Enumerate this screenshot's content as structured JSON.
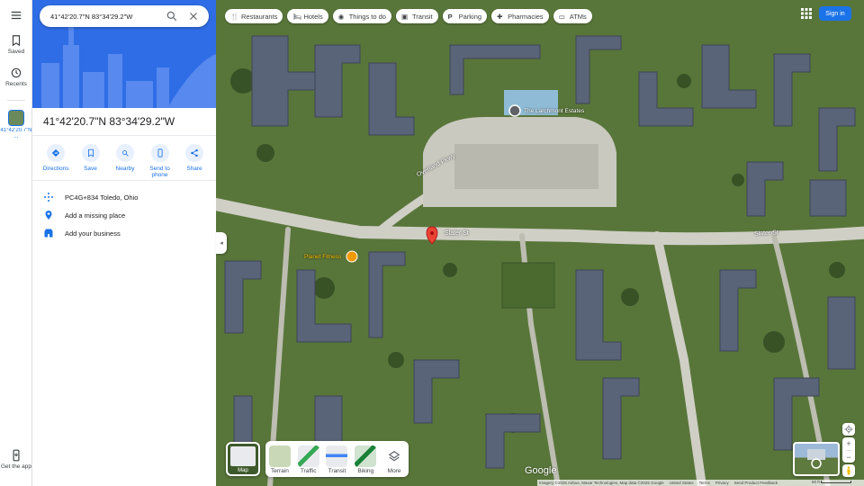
{
  "search": {
    "value": "41°42'20.7\"N 83°34'29.2\"W"
  },
  "rail": {
    "menu": "menu-icon",
    "saved": "Saved",
    "recents": "Recents",
    "recent_place": "41°42'20.7\"N ...",
    "get_app": "Get the app"
  },
  "place": {
    "title": "41°42'20.7\"N 83°34'29.2\"W",
    "actions": [
      {
        "label": "Directions",
        "icon": "directions-icon"
      },
      {
        "label": "Save",
        "icon": "bookmark-icon"
      },
      {
        "label": "Nearby",
        "icon": "nearby-icon"
      },
      {
        "label": "Send to phone",
        "icon": "phone-icon"
      },
      {
        "label": "Share",
        "icon": "share-icon"
      }
    ],
    "rows": [
      {
        "text": "PC4G+834 Toledo, Ohio",
        "icon": "plus-code-icon"
      },
      {
        "text": "Add a missing place",
        "icon": "add-place-icon"
      },
      {
        "text": "Add your business",
        "icon": "business-icon"
      }
    ]
  },
  "chips": [
    "Restaurants",
    "Hotels",
    "Things to do",
    "Transit",
    "Parking",
    "Pharmacies",
    "ATMs"
  ],
  "header": {
    "sign_in": "Sign in"
  },
  "layers": {
    "main": "Map",
    "options": [
      "Terrain",
      "Traffic",
      "Transit",
      "Biking",
      "More"
    ]
  },
  "map_labels": {
    "larchmont": "The Larchmont Estates",
    "overland": "Overland Pkwy",
    "slater1": "Slater St",
    "slater2": "Slater St",
    "planet": "Planet Fitness",
    "google": "Google"
  },
  "footer": {
    "imagery": "Imagery ©2025 Airbus, Maxar Technologies, Map data ©2025 Google",
    "country": "United States",
    "terms": "Terms",
    "privacy": "Privacy",
    "feedback": "Send Product Feedback",
    "scale": "50 ft"
  },
  "colors": {
    "accent": "#1a73e8",
    "pin": "#ea4335",
    "grass": "#5f7f3f",
    "road": "#cfcfc6",
    "roof": "#5a6478"
  }
}
